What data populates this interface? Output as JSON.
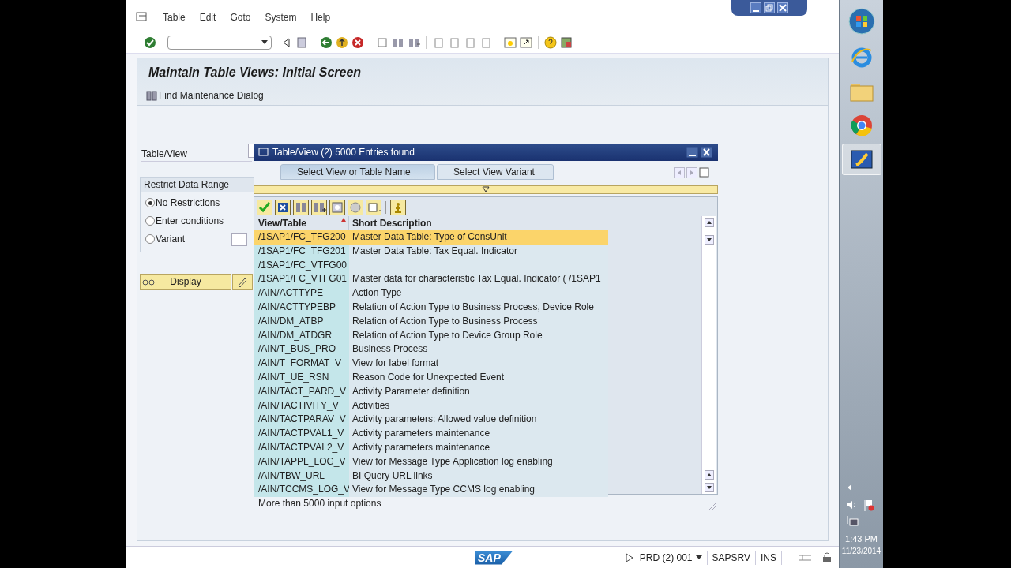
{
  "menu_bar": {
    "items": [
      "Table",
      "Edit",
      "Goto",
      "System",
      "Help"
    ]
  },
  "screen": {
    "title": "Maintain Table Views: Initial Screen",
    "toolbar_button": "Find Maintenance Dialog",
    "table_view_label": "Table/View",
    "restrict_group": {
      "title": "Restrict Data Range",
      "options": [
        {
          "label": "No Restrictions",
          "selected": true
        },
        {
          "label": "Enter conditions",
          "selected": false
        },
        {
          "label": "Variant",
          "selected": false
        }
      ]
    },
    "display_button": "Display"
  },
  "dialog": {
    "title": "Table/View (2) 5000 Entries found",
    "tabs": [
      {
        "label": "Select View or Table Name",
        "selected": true
      },
      {
        "label": "Select View Variant",
        "selected": false
      }
    ],
    "columns": [
      "View/Table",
      "Short Description"
    ],
    "rows": [
      {
        "name": "/1SAP1/FC_TFG200",
        "description": "Master Data Table: Type of ConsUnit",
        "selected": true
      },
      {
        "name": "/1SAP1/FC_TFG201",
        "description": "Master Data Table: Tax Equal. Indicator",
        "selected": false
      },
      {
        "name": "/1SAP1/FC_VTFG00",
        "description": "",
        "selected": false
      },
      {
        "name": "/1SAP1/FC_VTFG01",
        "description": "Master data for characteristic Tax Equal. Indicator ( /1SAP1",
        "selected": false
      },
      {
        "name": "/AIN/ACTTYPE",
        "description": "Action Type",
        "selected": false
      },
      {
        "name": "/AIN/ACTTYPEBP",
        "description": "Relation of Action Type to Business Process, Device Role",
        "selected": false
      },
      {
        "name": "/AIN/DM_ATBP",
        "description": "Relation of Action Type to Business Process",
        "selected": false
      },
      {
        "name": "/AIN/DM_ATDGR",
        "description": "Relation of Action Type to Device Group Role",
        "selected": false
      },
      {
        "name": "/AIN/T_BUS_PRO",
        "description": "Business Process",
        "selected": false
      },
      {
        "name": "/AIN/T_FORMAT_V",
        "description": "View for label format",
        "selected": false
      },
      {
        "name": "/AIN/T_UE_RSN",
        "description": "Reason Code for Unexpected Event",
        "selected": false
      },
      {
        "name": "/AIN/TACT_PARD_V",
        "description": "Activity Parameter definition",
        "selected": false
      },
      {
        "name": "/AIN/TACTIVITY_V",
        "description": "Activities",
        "selected": false
      },
      {
        "name": "/AIN/TACTPARAV_V",
        "description": "Activity parameters: Allowed value definition",
        "selected": false
      },
      {
        "name": "/AIN/TACTPVAL1_V",
        "description": "Activity parameters maintenance",
        "selected": false
      },
      {
        "name": "/AIN/TACTPVAL2_V",
        "description": "Activity parameters maintenance",
        "selected": false
      },
      {
        "name": "/AIN/TAPPL_LOG_V",
        "description": "View for Message Type Application log enabling",
        "selected": false
      },
      {
        "name": "/AIN/TBW_URL",
        "description": "BI Query URL links",
        "selected": false
      },
      {
        "name": "/AIN/TCCMS_LOG_V",
        "description": "View for Message Type CCMS log enabling",
        "selected": false
      }
    ],
    "footer": "More than 5000 input options"
  },
  "status_bar": {
    "logo": "SAP",
    "system": "PRD (2) 001",
    "server": "SAPSRV",
    "mode": "INS"
  },
  "taskbar": {
    "time": "1:43 PM",
    "date": "11/23/2014"
  }
}
